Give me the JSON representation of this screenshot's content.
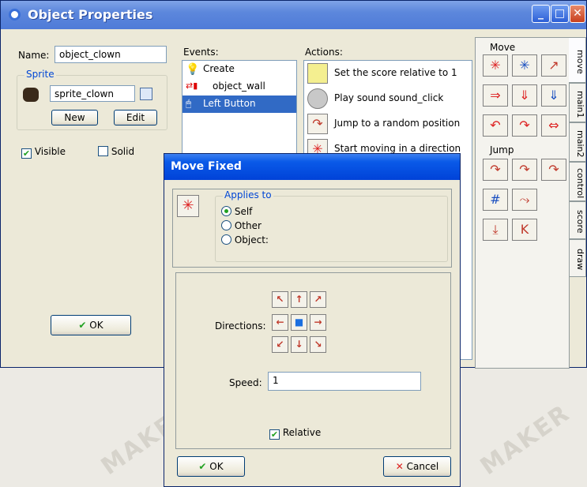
{
  "main_window": {
    "title": "Object Properties",
    "name_label": "Name:",
    "name_value": "object_clown",
    "sprite_group": "Sprite",
    "sprite_value": "sprite_clown",
    "new_button": "New",
    "edit_button": "Edit",
    "visible_label": "Visible",
    "visible_checked": true,
    "solid_label": "Solid",
    "solid_checked": false,
    "ok_button": "OK",
    "events_header": "Events:",
    "events": [
      "Create",
      "object_wall",
      "Left Button"
    ],
    "selected_event": 2,
    "actions_header": "Actions:",
    "actions": [
      "Set the score relative to 1",
      "Play sound sound_click",
      "Jump to a random position",
      "Start moving in a direction"
    ],
    "palette_move_label": "Move",
    "palette_jump_label": "Jump",
    "tabs": [
      "move",
      "main1",
      "main2",
      "control",
      "score",
      "draw"
    ]
  },
  "dialog": {
    "title": "Move Fixed",
    "applies_to_label": "Applies to",
    "applies_options": [
      "Self",
      "Other",
      "Object:"
    ],
    "applies_selected": 0,
    "directions_label": "Directions:",
    "speed_label": "Speed:",
    "speed_value": "1",
    "relative_label": "Relative",
    "relative_checked": true,
    "ok_button": "OK",
    "cancel_button": "Cancel"
  },
  "watermark_text": "MAKER",
  "colors": {
    "title_bar": "#5c87dc",
    "dialog_title": "#0a5ae8",
    "selection": "#316ac5",
    "group_title": "#0046d5",
    "arrow_red": "#c0392b"
  }
}
